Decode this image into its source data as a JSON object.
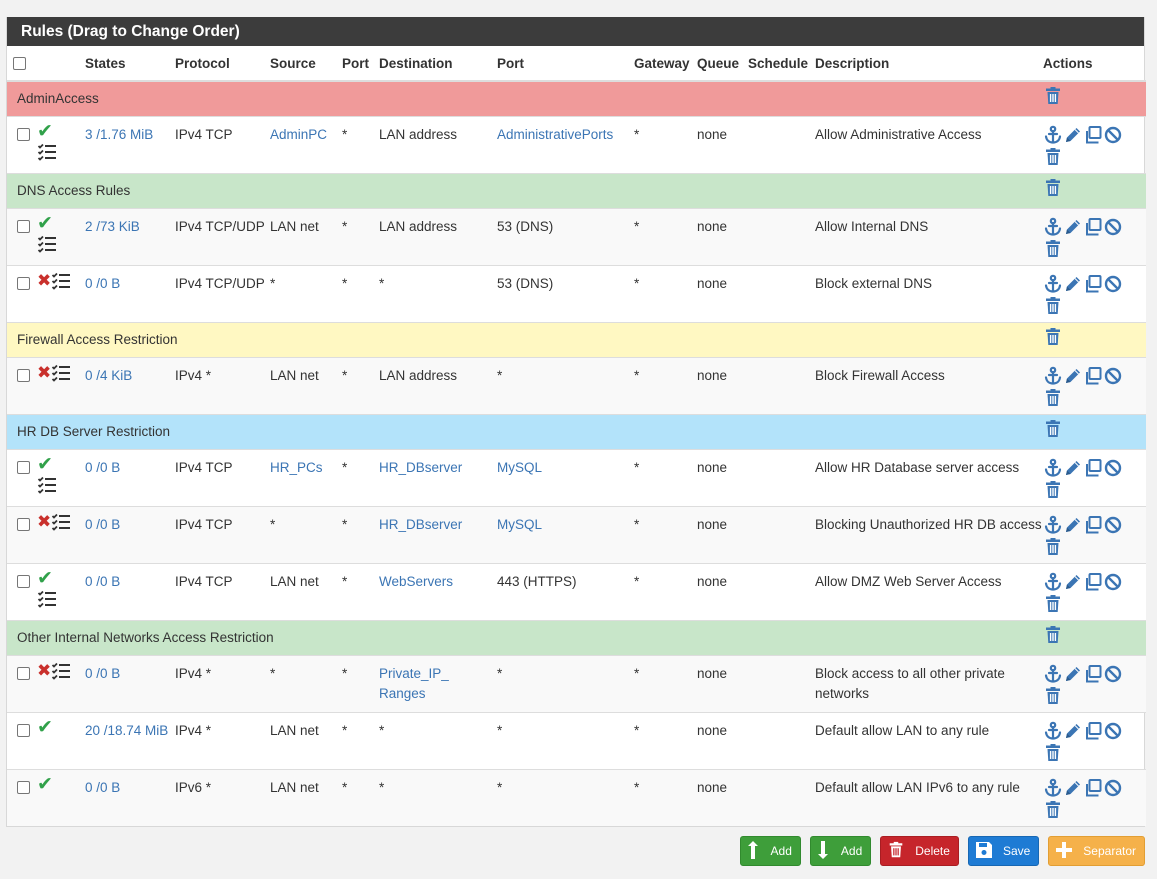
{
  "panel": {
    "title": "Rules (Drag to Change Order)"
  },
  "columns": [
    "States",
    "Protocol",
    "Source",
    "Port",
    "Destination",
    "Port",
    "Gateway",
    "Queue",
    "Schedule",
    "Description",
    "Actions"
  ],
  "colors": {
    "sep_red": "#f09a9a",
    "sep_green": "#c8e6c9",
    "sep_yellow": "#fff8c2",
    "sep_blue": "#b3e3fa",
    "link": "#3b75b4",
    "icon_blue": "#3b75b4",
    "pass_green": "#31a14a",
    "block_red": "#c9302c"
  },
  "rows": [
    {
      "kind": "separator",
      "label": "AdminAccess",
      "color": "#f09a9a"
    },
    {
      "kind": "rule",
      "action": "pass",
      "states": "3 /1.76 MiB",
      "protocol": "IPv4 TCP",
      "source": "AdminPC",
      "source_link": true,
      "sport": "*",
      "destination": "LAN address",
      "dest_link": false,
      "dport": "AdministrativePorts",
      "dport_link": true,
      "gateway": "*",
      "queue": "none",
      "schedule": "",
      "description": "Allow Administrative Access"
    },
    {
      "kind": "separator",
      "label": "DNS Access Rules",
      "color": "#c8e6c9"
    },
    {
      "kind": "rule",
      "action": "pass",
      "states": "2 /73 KiB",
      "protocol": "IPv4 TCP/UDP",
      "source": "LAN net",
      "source_link": false,
      "sport": "*",
      "destination": "LAN address",
      "dest_link": false,
      "dport": "53 (DNS)",
      "dport_link": false,
      "gateway": "*",
      "queue": "none",
      "schedule": "",
      "description": "Allow Internal DNS"
    },
    {
      "kind": "rule",
      "action": "block",
      "states": "0 /0 B",
      "protocol": "IPv4 TCP/UDP",
      "source": "*",
      "source_link": false,
      "sport": "*",
      "destination": "*",
      "dest_link": false,
      "dport": "53 (DNS)",
      "dport_link": false,
      "gateway": "*",
      "queue": "none",
      "schedule": "",
      "description": "Block external DNS"
    },
    {
      "kind": "separator",
      "label": "Firewall Access Restriction",
      "color": "#fff8c2"
    },
    {
      "kind": "rule",
      "action": "block",
      "states": "0 /4 KiB",
      "protocol": "IPv4 *",
      "source": "LAN net",
      "source_link": false,
      "sport": "*",
      "destination": "LAN address",
      "dest_link": false,
      "dport": "*",
      "dport_link": false,
      "gateway": "*",
      "queue": "none",
      "schedule": "",
      "description": "Block Firewall Access"
    },
    {
      "kind": "separator",
      "label": "HR DB Server Restriction",
      "color": "#b3e3fa"
    },
    {
      "kind": "rule",
      "action": "pass",
      "states": "0 /0 B",
      "protocol": "IPv4 TCP",
      "source": "HR_PCs",
      "source_link": true,
      "sport": "*",
      "destination": "HR_DBserver",
      "dest_link": true,
      "dport": "MySQL",
      "dport_link": true,
      "gateway": "*",
      "queue": "none",
      "schedule": "",
      "description": "Allow HR Database server access"
    },
    {
      "kind": "rule",
      "action": "block",
      "states": "0 /0 B",
      "protocol": "IPv4 TCP",
      "source": "*",
      "source_link": false,
      "sport": "*",
      "destination": "HR_DBserver",
      "dest_link": true,
      "dport": "MySQL",
      "dport_link": true,
      "gateway": "*",
      "queue": "none",
      "schedule": "",
      "description": "Blocking Unauthorized HR DB access"
    },
    {
      "kind": "rule",
      "action": "pass",
      "states": "0 /0 B",
      "protocol": "IPv4 TCP",
      "source": "LAN net",
      "source_link": false,
      "sport": "*",
      "destination": "WebServers",
      "dest_link": true,
      "dport": "443 (HTTPS)",
      "dport_link": false,
      "gateway": "*",
      "queue": "none",
      "schedule": "",
      "description": "Allow DMZ Web Server Access"
    },
    {
      "kind": "separator",
      "label": "Other Internal Networks Access Restriction",
      "color": "#c8e6c9"
    },
    {
      "kind": "rule",
      "action": "block",
      "states": "0 /0 B",
      "protocol": "IPv4 *",
      "source": "*",
      "source_link": false,
      "sport": "*",
      "destination": "Private_IP_ Ranges",
      "dest_link": true,
      "dport": "*",
      "dport_link": false,
      "gateway": "*",
      "queue": "none",
      "schedule": "",
      "description": "Block access to all other private networks"
    },
    {
      "kind": "rule",
      "action": "pass_noadv",
      "states": "20 /18.74 MiB",
      "protocol": "IPv4 *",
      "source": "LAN net",
      "source_link": false,
      "sport": "*",
      "destination": "*",
      "dest_link": false,
      "dport": "*",
      "dport_link": false,
      "gateway": "*",
      "queue": "none",
      "schedule": "",
      "description": "Default allow LAN to any rule"
    },
    {
      "kind": "rule",
      "action": "pass_noadv",
      "states": "0 /0 B",
      "protocol": "IPv6 *",
      "source": "LAN net",
      "source_link": false,
      "sport": "*",
      "destination": "*",
      "dest_link": false,
      "dport": "*",
      "dport_link": false,
      "gateway": "*",
      "queue": "none",
      "schedule": "",
      "description": "Default allow LAN IPv6 to any rule"
    }
  ],
  "buttons": [
    {
      "name": "add-top-button",
      "label": "Add",
      "style": "green",
      "icon": "arrow-up-icon"
    },
    {
      "name": "add-bottom-button",
      "label": "Add",
      "style": "green",
      "icon": "arrow-down-icon"
    },
    {
      "name": "delete-button",
      "label": "Delete",
      "style": "red",
      "icon": "trash-icon"
    },
    {
      "name": "save-button",
      "label": "Save",
      "style": "blue",
      "icon": "save-icon"
    },
    {
      "name": "separator-button",
      "label": "Separator",
      "style": "orange",
      "icon": "plus-icon"
    }
  ]
}
